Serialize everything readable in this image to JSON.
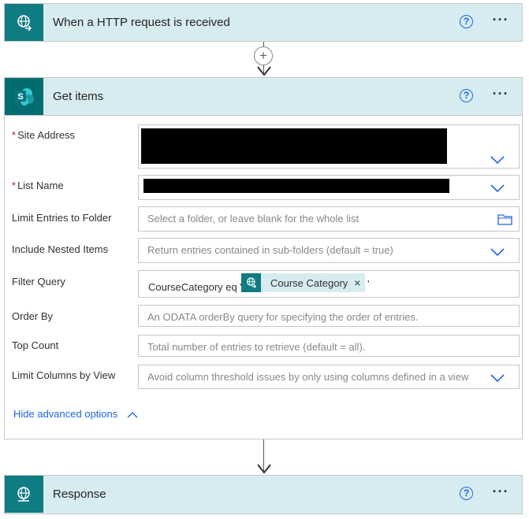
{
  "trigger": {
    "title": "When a HTTP request is received",
    "help": "?",
    "more": "···"
  },
  "add_step": "+",
  "get_items": {
    "title": "Get items",
    "help": "?",
    "more": "···",
    "required_mark": "*",
    "fields": {
      "site_address": {
        "label": "Site Address"
      },
      "list_name": {
        "label": "List Name"
      },
      "limit_folder": {
        "label": "Limit Entries to Folder",
        "placeholder": "Select a folder, or leave blank for the whole list"
      },
      "nested": {
        "label": "Include Nested Items",
        "placeholder": "Return entries contained in sub-folders (default = true)"
      },
      "filter": {
        "label": "Filter Query",
        "prefix": "CourseCategory eq '",
        "token": "Course Category",
        "token_close": "×",
        "suffix": "'"
      },
      "order_by": {
        "label": "Order By",
        "placeholder": "An ODATA orderBy query for specifying the order of entries."
      },
      "top_count": {
        "label": "Top Count",
        "placeholder": "Total number of entries to retrieve (default = all)."
      },
      "limit_view": {
        "label": "Limit Columns by View",
        "placeholder": "Avoid column threshold issues by only using columns defined in a view"
      }
    },
    "advanced_link": "Hide advanced options"
  },
  "response": {
    "title": "Response",
    "help": "?",
    "more": "···"
  },
  "colors": {
    "accent_blue": "#2266e3",
    "header_bg": "#d7ecf0",
    "http_icon": "#0f7b82",
    "sharepoint": "#036c70"
  }
}
